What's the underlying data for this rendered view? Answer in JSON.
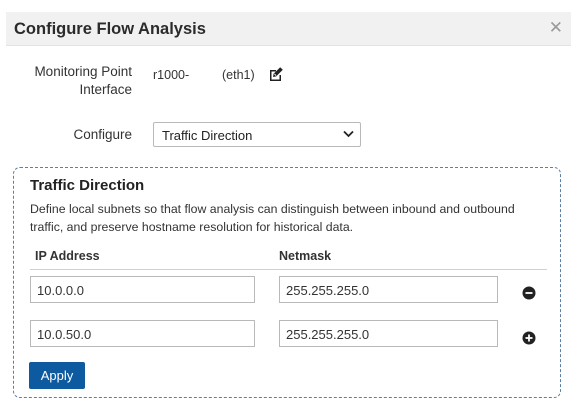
{
  "dialog": {
    "title": "Configure Flow Analysis",
    "close_icon": "close-icon"
  },
  "monitoring_point": {
    "label_line1": "Monitoring Point",
    "label_line2": "Interface",
    "host": "r1000-",
    "interface": "(eth1)",
    "edit_icon": "edit-icon"
  },
  "configure": {
    "label": "Configure",
    "selected": "Traffic Direction"
  },
  "traffic_direction": {
    "title": "Traffic Direction",
    "description": "Define local subnets so that flow analysis can distinguish between inbound and outbound traffic, and preserve hostname resolution for historical data.",
    "columns": [
      "IP Address",
      "Netmask"
    ],
    "rows": [
      {
        "ip": "10.0.0.0",
        "netmask": "255.255.255.0",
        "action_icon": "minus-circle-icon"
      },
      {
        "ip": "10.0.50.0",
        "netmask": "255.255.255.0",
        "action_icon": "plus-circle-icon"
      }
    ],
    "apply_label": "Apply"
  },
  "colors": {
    "accent": "#0d5aa0",
    "panel_border": "#5b7ea3",
    "titlebar_bg": "#f1f1f1"
  }
}
